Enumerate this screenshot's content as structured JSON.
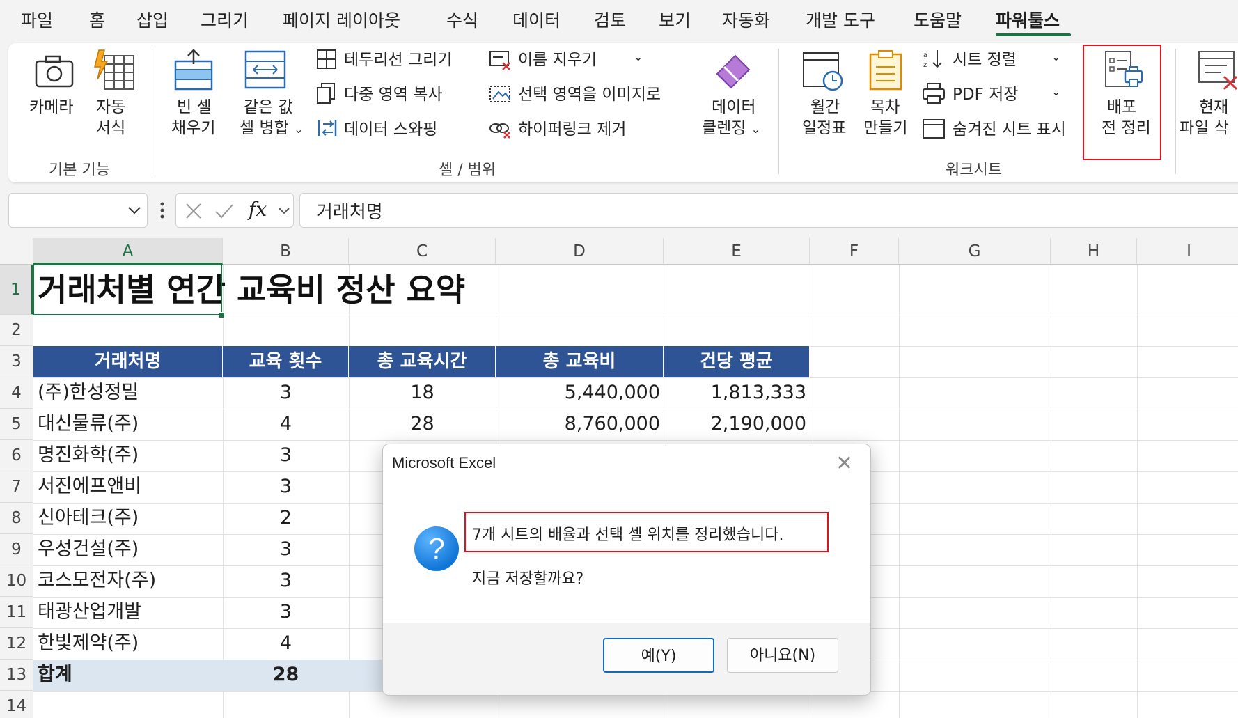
{
  "menu": {
    "items": [
      "파일",
      "홈",
      "삽입",
      "그리기",
      "페이지 레이아웃",
      "수식",
      "데이터",
      "검토",
      "보기",
      "자동화",
      "개발 도구",
      "도움말",
      "파워툴스"
    ],
    "active": "파워툴스"
  },
  "ribbon": {
    "basic": {
      "camera": "카메라",
      "auto_format_1": "자동",
      "auto_format_2": "서식",
      "group": "기본 기능"
    },
    "cells": {
      "fill_blank_1": "빈 셀",
      "fill_blank_2": "채우기",
      "merge_same_1": "같은 값",
      "merge_same_2": "셀 병합",
      "draw_border": "테두리선 그리기",
      "multi_copy": "다중 영역 복사",
      "data_swap": "데이터 스와핑",
      "clear_names": "이름 지우기",
      "range_to_image": "선택 영역을 이미지로",
      "remove_hyperlink": "하이퍼링크 제거",
      "data_clean_1": "데이터",
      "data_clean_2": "클렌징",
      "group": "셀 / 범위"
    },
    "sheets": {
      "calendar_1": "월간",
      "calendar_2": "일정표",
      "toc_1": "목차",
      "toc_2": "만들기",
      "sort_sheets": "시트 정렬",
      "pdf_save": "PDF 저장",
      "show_hidden": "숨겨진 시트 표시",
      "group": "워크시트"
    },
    "distribute_1": "배포",
    "distribute_2": "전 정리",
    "delete_file_1": "현재",
    "delete_file_2": "파일 삭"
  },
  "formula_bar": {
    "name_box": "",
    "fx": "fx",
    "content": "거래처명"
  },
  "sheet": {
    "columns": [
      "A",
      "B",
      "C",
      "D",
      "E",
      "F",
      "G",
      "H",
      "I"
    ],
    "rows": [
      "1",
      "2",
      "3",
      "4",
      "5",
      "6",
      "7",
      "8",
      "9",
      "10",
      "11",
      "12",
      "13",
      "14"
    ],
    "title": "거래처별 연간 교육비 정산 요약",
    "headers": [
      "거래처명",
      "교육 횟수",
      "총 교육시간",
      "총 교육비",
      "건당 평균"
    ],
    "data": [
      [
        "(주)한성정밀",
        "3",
        "18",
        "5,440,000",
        "1,813,333"
      ],
      [
        "대신물류(주)",
        "4",
        "28",
        "8,760,000",
        "2,190,000"
      ],
      [
        "명진화학(주)",
        "3",
        "",
        "",
        ""
      ],
      [
        "서진에프앤비",
        "3",
        "",
        "",
        ""
      ],
      [
        "신아테크(주)",
        "2",
        "",
        "",
        ""
      ],
      [
        "우성건설(주)",
        "3",
        "",
        "",
        ""
      ],
      [
        "코스모전자(주)",
        "3",
        "",
        "",
        ""
      ],
      [
        "태광산업개발",
        "3",
        "",
        "",
        ""
      ],
      [
        "한빛제약(주)",
        "4",
        "",
        "",
        ""
      ]
    ],
    "total": [
      "합계",
      "28"
    ]
  },
  "dialog": {
    "title": "Microsoft Excel",
    "message1": "7개 시트의 배율과 선택 셀 위치를 정리했습니다.",
    "message2": "지금 저장할까요?",
    "yes": "예(Y)",
    "no": "아니요(N)"
  },
  "colors": {
    "excel_green": "#1e7145",
    "header_blue": "#2f5496",
    "total_fill": "#dce6f1",
    "highlight_red": "#e0141e"
  }
}
